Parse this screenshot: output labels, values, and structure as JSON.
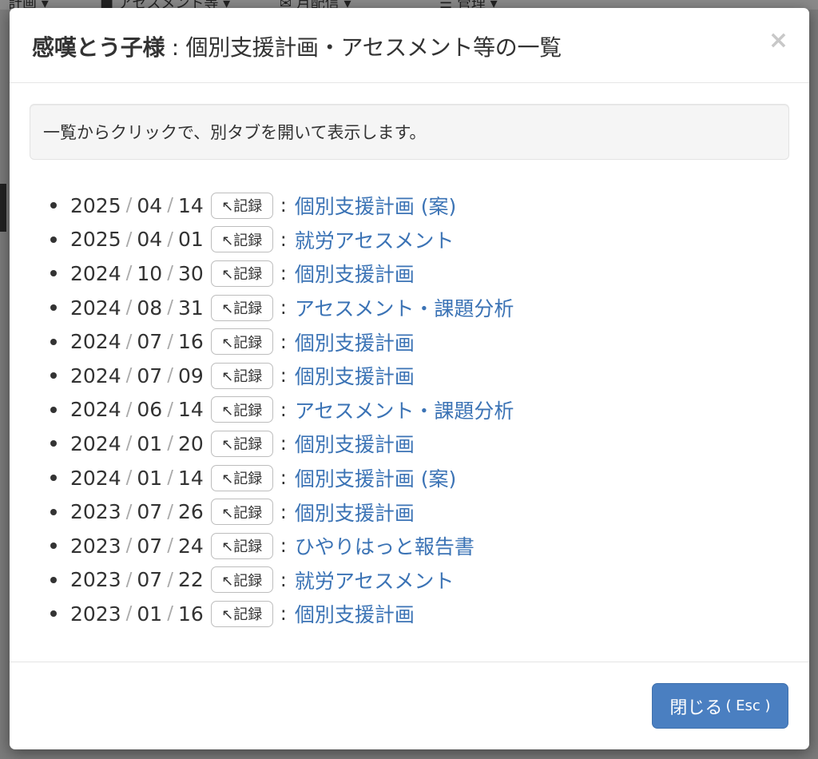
{
  "background": {
    "nav_items": [
      "計画 ▾",
      "■ アセスメント等 ▾",
      "✉ 月配信 ▾",
      "☰ 管理 ▾"
    ]
  },
  "modal": {
    "title_name": "感嘆とう子様",
    "title_rest": " : 個別支援計画・アセスメント等の一覧",
    "close_x": "×",
    "notice": "一覧からクリックで、別タブを開いて表示します。",
    "record_button_label": "↖記録",
    "records": [
      {
        "y": "2025",
        "m": "04",
        "d": "14",
        "doc": "個別支援計画 (案)"
      },
      {
        "y": "2025",
        "m": "04",
        "d": "01",
        "doc": "就労アセスメント"
      },
      {
        "y": "2024",
        "m": "10",
        "d": "30",
        "doc": "個別支援計画"
      },
      {
        "y": "2024",
        "m": "08",
        "d": "31",
        "doc": "アセスメント・課題分析"
      },
      {
        "y": "2024",
        "m": "07",
        "d": "16",
        "doc": "個別支援計画"
      },
      {
        "y": "2024",
        "m": "07",
        "d": "09",
        "doc": "個別支援計画"
      },
      {
        "y": "2024",
        "m": "06",
        "d": "14",
        "doc": "アセスメント・課題分析"
      },
      {
        "y": "2024",
        "m": "01",
        "d": "20",
        "doc": "個別支援計画"
      },
      {
        "y": "2024",
        "m": "01",
        "d": "14",
        "doc": "個別支援計画 (案)"
      },
      {
        "y": "2023",
        "m": "07",
        "d": "26",
        "doc": "個別支援計画"
      },
      {
        "y": "2023",
        "m": "07",
        "d": "24",
        "doc": "ひやりはっと報告書"
      },
      {
        "y": "2023",
        "m": "07",
        "d": "22",
        "doc": "就労アセスメント"
      },
      {
        "y": "2023",
        "m": "01",
        "d": "16",
        "doc": "個別支援計画"
      }
    ],
    "close_button_label": "閉じる",
    "close_button_hint": "( Esc )"
  },
  "colors": {
    "link": "#3b73b5",
    "primary_button": "#4a7fc1",
    "overlay": "#7b7b7b"
  }
}
